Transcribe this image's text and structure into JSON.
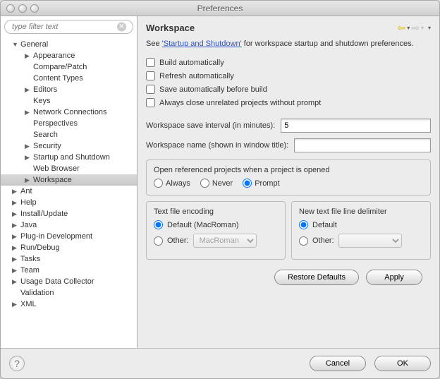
{
  "window": {
    "title": "Preferences"
  },
  "filter": {
    "placeholder": "type filter text"
  },
  "tree": {
    "general": "General",
    "appearance": "Appearance",
    "compare": "Compare/Patch",
    "content_types": "Content Types",
    "editors": "Editors",
    "keys": "Keys",
    "network": "Network Connections",
    "perspectives": "Perspectives",
    "search": "Search",
    "security": "Security",
    "startup": "Startup and Shutdown",
    "webbrowser": "Web Browser",
    "workspace": "Workspace",
    "ant": "Ant",
    "help": "Help",
    "install": "Install/Update",
    "java": "Java",
    "plugin": "Plug-in Development",
    "rundebug": "Run/Debug",
    "tasks": "Tasks",
    "team": "Team",
    "usage": "Usage Data Collector",
    "validation": "Validation",
    "xml": "XML"
  },
  "page": {
    "title": "Workspace",
    "intro_pre": "See ",
    "intro_link": "'Startup and Shutdown'",
    "intro_post": " for workspace startup and shutdown preferences.",
    "checks": {
      "build": "Build automatically",
      "refresh": "Refresh automatically",
      "save": "Save automatically before build",
      "close": "Always close unrelated projects without prompt"
    },
    "fields": {
      "interval_label": "Workspace save interval (in minutes):",
      "interval_value": "5",
      "name_label": "Workspace name (shown in window title):",
      "name_value": ""
    },
    "open_ref": {
      "title": "Open referenced projects when a project is opened",
      "always": "Always",
      "never": "Never",
      "prompt": "Prompt"
    },
    "encoding": {
      "title": "Text file encoding",
      "default": "Default (MacRoman)",
      "other": "Other:",
      "other_value": "MacRoman"
    },
    "delimiter": {
      "title": "New text file line delimiter",
      "default": "Default",
      "other": "Other:"
    },
    "buttons": {
      "restore": "Restore Defaults",
      "apply": "Apply"
    }
  },
  "footer": {
    "cancel": "Cancel",
    "ok": "OK"
  }
}
